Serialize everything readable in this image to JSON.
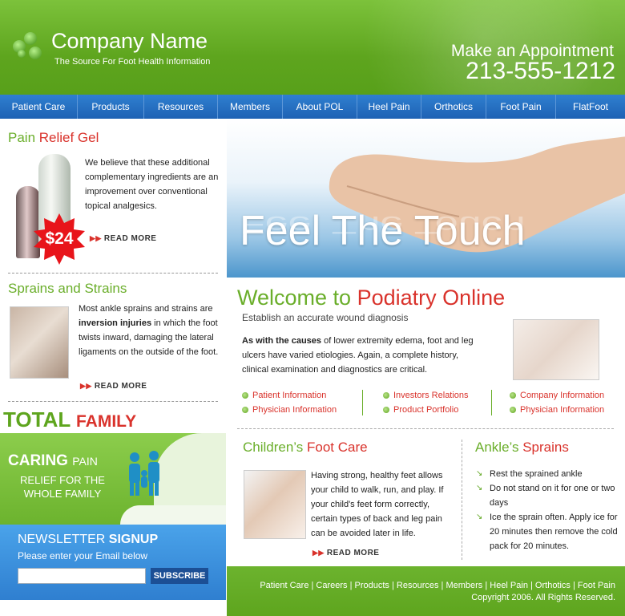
{
  "header": {
    "company": "Company Name",
    "tagline": "The Source For Foot Health Information",
    "appointment": "Make an Appointment",
    "phone": "213-555-1212"
  },
  "nav": [
    "Patient Care",
    "Products",
    "Resources",
    "Members",
    "About POL",
    "Heel Pain",
    "Orthotics",
    "Foot Pain",
    "FlatFoot"
  ],
  "pain_gel": {
    "title_a": "Pain ",
    "title_b": "Relief Gel",
    "price": "$24",
    "text": "We believe that these additional complementary ingredients are an improvement over conventional topical analgesics.",
    "readmore": "READ MORE"
  },
  "sprains": {
    "title": "Sprains and Strains",
    "text_a": "Most ankle sprains and strains are ",
    "text_bold": "inversion injuries",
    "text_b": " in which the foot twists inward, damaging the lateral ligaments on the outside of the foot.",
    "readmore": "READ MORE"
  },
  "footcare": {
    "total": "TOTAL",
    "family": "FAMILY FOOTCARE",
    "caring": "CARING",
    "pain": "PAIN",
    "relief": "RELIEF FOR THE WHOLE FAMILY"
  },
  "newsletter": {
    "title_a": "NEWSLETTER ",
    "title_b": "SIGNUP",
    "subtitle": "Please enter your Email below",
    "placeholder": "",
    "button": "SUBSCRIBE"
  },
  "hero": {
    "title": "Feel The Touch"
  },
  "welcome": {
    "title_a": "Welcome to ",
    "title_b": "Podiatry Online",
    "subtitle": "Establish an accurate wound diagnosis",
    "intro_bold": "As with the causes",
    "intro_rest": " of lower extremity edema, foot and leg ulcers have varied etiologies. Again, a complete history, clinical examination and diagnostics are critical."
  },
  "links": {
    "col1": [
      "Patient Information",
      "Physician Information"
    ],
    "col2": [
      "Investors Relations",
      "Product Portfolio"
    ],
    "col3": [
      "Company Information",
      "Physician Information"
    ]
  },
  "children": {
    "title_a": "Children’s ",
    "title_b": "Foot Care",
    "text": "Having strong, healthy feet allows your child to walk, run, and play. If your child's feet form correctly, certain types of back and leg pain can be avoided later in life.",
    "readmore": "READ MORE"
  },
  "ankle": {
    "title_a": "Ankle’s ",
    "title_b": "Sprains",
    "items": [
      "Rest the sprained ankle",
      "Do not stand on it for one or two days",
      "Ice the sprain often. Apply ice for 20 minutes then remove the cold pack for 20 minutes."
    ]
  },
  "footer": {
    "links": "Patient Care | Careers | Products | Resources | Members | Heel Pain | Orthotics | Foot Pain",
    "copyright": "Copyright 2006. All Rights Reserved."
  },
  "colors": {
    "green": "#6aae2a",
    "red": "#d9322b",
    "blue": "#1e62b4"
  }
}
